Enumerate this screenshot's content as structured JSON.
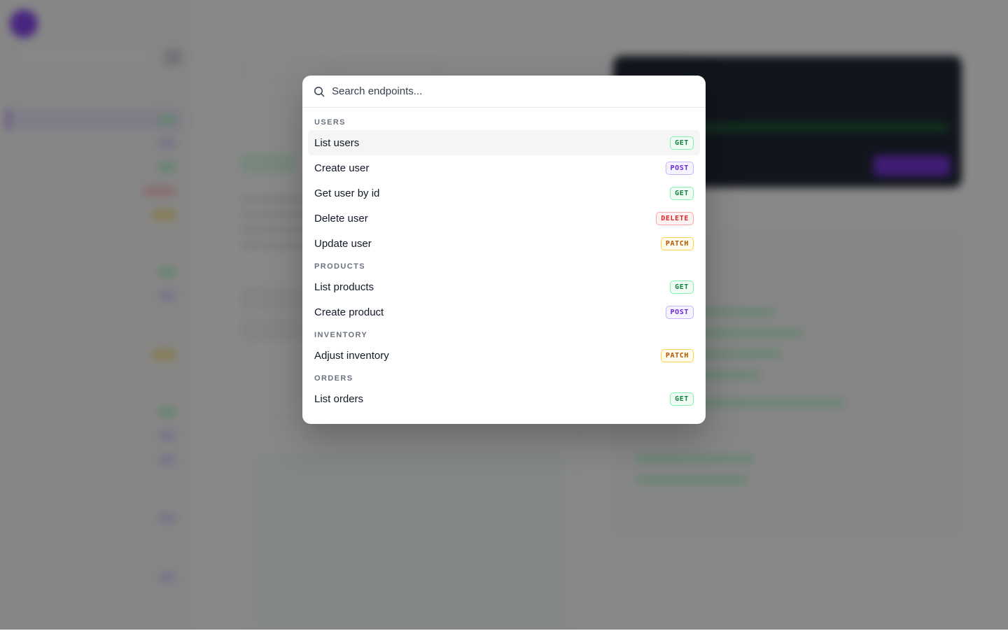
{
  "palette": {
    "search_placeholder": "Search endpoints...",
    "groups": [
      {
        "label": "USERS",
        "items": [
          {
            "label": "List users",
            "method": "GET"
          },
          {
            "label": "Create user",
            "method": "POST"
          },
          {
            "label": "Get user by id",
            "method": "GET"
          },
          {
            "label": "Delete user",
            "method": "DELETE"
          },
          {
            "label": "Update user",
            "method": "PATCH"
          }
        ]
      },
      {
        "label": "PRODUCTS",
        "items": [
          {
            "label": "List products",
            "method": "GET"
          },
          {
            "label": "Create product",
            "method": "POST"
          }
        ]
      },
      {
        "label": "INVENTORY",
        "items": [
          {
            "label": "Adjust inventory",
            "method": "PATCH"
          }
        ]
      },
      {
        "label": "ORDERS",
        "items": [
          {
            "label": "List orders",
            "method": "GET"
          }
        ]
      }
    ]
  },
  "colors": {
    "overlay": "#111111",
    "accent": "#7c3aed",
    "get": "#15803d",
    "post": "#6d28d9",
    "delete": "#dc2626",
    "patch": "#b45309"
  },
  "icons": {
    "search": "search-icon"
  }
}
